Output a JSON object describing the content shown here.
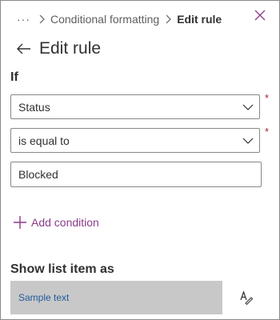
{
  "breadcrumb": {
    "more_icon": "more-horizontal-icon",
    "more_label": "···",
    "items": [
      {
        "label": "Conditional formatting"
      },
      {
        "label": "Edit rule"
      }
    ]
  },
  "header": {
    "title": "Edit rule",
    "back_icon": "arrow-left-icon",
    "close_icon": "close-icon"
  },
  "condition": {
    "label": "If",
    "field_select": {
      "value": "Status",
      "required": true
    },
    "operator_select": {
      "value": "is equal to",
      "required": true
    },
    "value_input": {
      "value": "Blocked"
    },
    "required_mark": "*",
    "add_condition_label": "Add condition",
    "add_icon": "plus-icon"
  },
  "format": {
    "label": "Show list item as",
    "sample_text": "Sample text",
    "format_icon": "text-format-icon"
  },
  "colors": {
    "accent": "#8a3c8c",
    "sample_background": "#c8c8c8",
    "sample_text": "#1f5c99",
    "required": "#a4262c"
  }
}
